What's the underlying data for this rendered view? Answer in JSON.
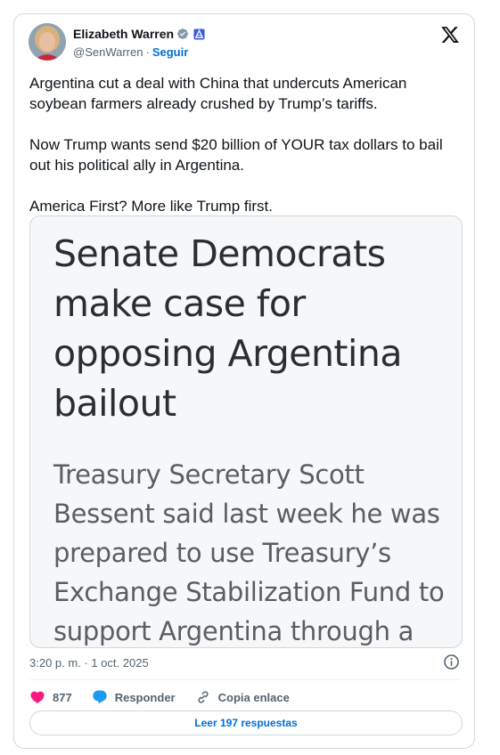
{
  "author": {
    "name": "Elizabeth Warren",
    "handle": "@SenWarren",
    "separator": "·",
    "follow_label": "Seguir"
  },
  "tweet": {
    "paragraphs": [
      "Argentina cut a deal with China that undercuts American soybean farmers already crushed by Trump’s tariffs.",
      "Now Trump wants send $20 billion of YOUR tax dollars to bail out his political ally in Argentina.",
      "America First? More like Trump first."
    ],
    "media": {
      "headline": "Senate Democrats make case for opposing Argentina bailout",
      "body": "Treasury Secretary Scott Bessent said last week he was prepared to use Treasury’s Exchange Stabilization Fund to support Argentina through a"
    },
    "timestamp": "3:20 p. m. · 1 oct. 2025"
  },
  "actions": {
    "likes_count": "877",
    "reply_label": "Responder",
    "copy_link_label": "Copia enlace"
  },
  "footer": {
    "read_replies_label": "Leer 197 respuestas"
  },
  "colors": {
    "accent": "#006fd6",
    "like": "#f91880",
    "reply": "#1d9bf0",
    "muted_text": "#536471",
    "border": "#cfd9de"
  },
  "icons": [
    "verified-badge-icon",
    "government-badge-icon",
    "x-logo-icon",
    "info-icon",
    "heart-icon",
    "speech-bubble-icon",
    "link-icon"
  ]
}
